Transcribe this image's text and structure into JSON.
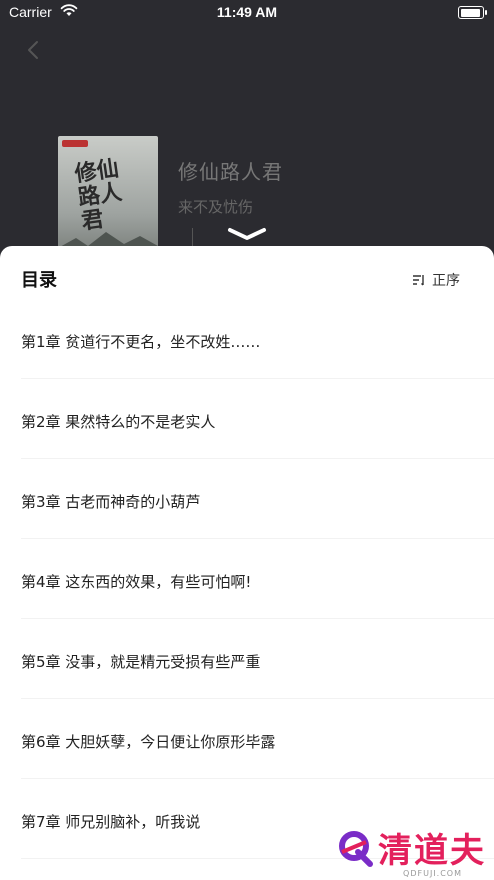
{
  "status_bar": {
    "carrier": "Carrier",
    "time": "11:49 AM",
    "battery_level": 0.95
  },
  "book": {
    "title": "修仙路人君",
    "author": "来不及忧伤",
    "cover_title": "修仙路人君"
  },
  "toc": {
    "title": "目录",
    "sort_label": "正序",
    "chapters": [
      "第1章 贫道行不更名，坐不改姓……",
      "第2章 果然特么的不是老实人",
      "第3章 古老而神奇的小葫芦",
      "第4章 这东西的效果，有些可怕啊!",
      "第5章 没事，就是精元受损有些严重",
      "第6章 大胆妖孽，今日便让你原形毕露",
      "第7章 师兄别脑补，听我说"
    ]
  },
  "watermark": {
    "text": "清道夫",
    "sub": "QDFUJI.COM"
  },
  "icons": {
    "back": "chevron-left-icon",
    "collapse": "chevron-down-icon",
    "sort": "sort-icon",
    "wifi": "wifi-icon",
    "battery": "battery-icon"
  },
  "colors": {
    "overlay_bg": "#2b2b30",
    "sheet_bg": "#ffffff",
    "watermark": "#e3205c"
  }
}
